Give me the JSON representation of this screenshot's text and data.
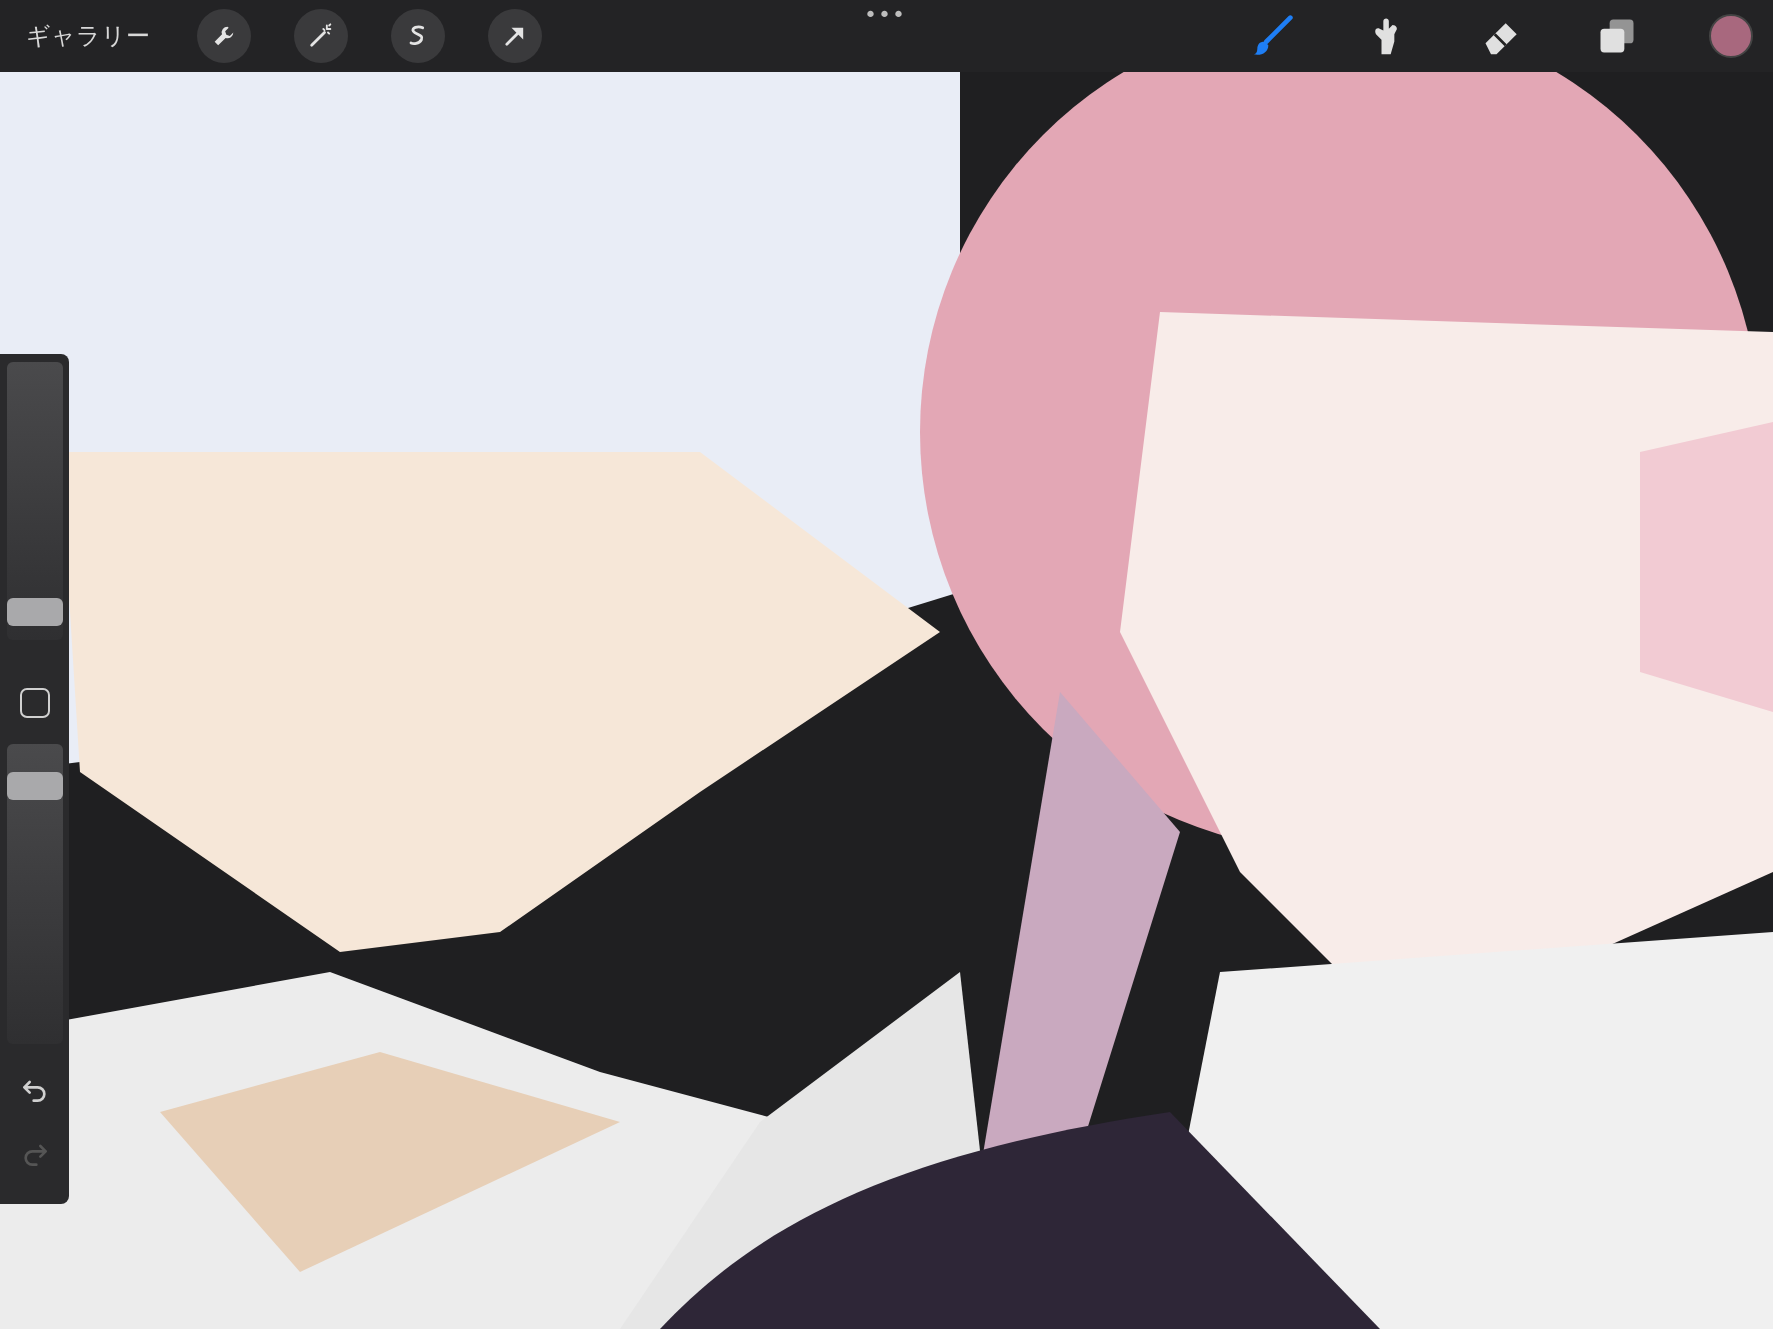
{
  "top_bar": {
    "gallery": "ギャラリー",
    "left_tools": [
      {
        "kind": "wrench"
      },
      {
        "kind": "wand"
      },
      {
        "kind": "selection"
      },
      {
        "kind": "transform"
      }
    ],
    "more": "•••",
    "right_tools": [
      {
        "kind": "brush",
        "selected": true
      },
      {
        "kind": "smudge",
        "selected": false
      },
      {
        "kind": "eraser",
        "selected": false
      },
      {
        "kind": "layers",
        "selected": false
      }
    ],
    "color": {
      "color": "#a8687e"
    }
  },
  "sidebar": {
    "size_slider": {
      "level": 0.1
    },
    "opacity_slider": {
      "level": 0.86
    },
    "undo": {
      "disabled": false
    },
    "redo": {
      "disabled": true
    }
  }
}
